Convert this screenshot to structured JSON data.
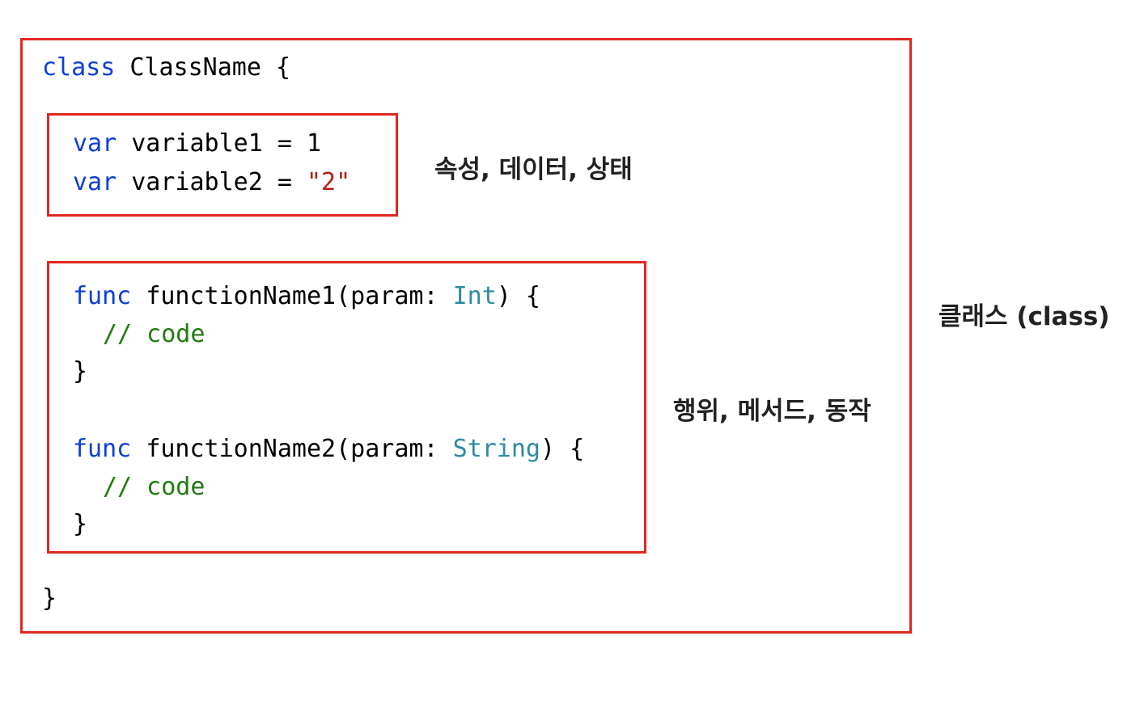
{
  "code": {
    "class_open": {
      "keyword": "class",
      "name": "ClassName",
      "brace": "{"
    },
    "class_close": "}",
    "properties": [
      {
        "keyword": "var",
        "name": "variable1",
        "op": "=",
        "value": "1",
        "value_kind": "number"
      },
      {
        "keyword": "var",
        "name": "variable2",
        "op": "=",
        "value": "\"2\"",
        "value_kind": "string"
      }
    ],
    "methods": [
      {
        "keyword": "func",
        "signature": "functionName1(param: ",
        "type": "Int",
        "tail": ") {",
        "comment": "// code",
        "close": "}"
      },
      {
        "keyword": "func",
        "signature": "functionName2(param: ",
        "type": "String",
        "tail": ") {",
        "comment": "// code",
        "close": "}"
      }
    ]
  },
  "labels": {
    "properties": "속성, 데이터, 상태",
    "methods": "행위, 메서드, 동작",
    "class": "클래스 (class)"
  },
  "colors": {
    "box_border": "#e0281f",
    "keyword": "#0b3fd6",
    "string": "#b51d12",
    "type": "#2c8aa6",
    "comment": "#1f7a0e"
  }
}
